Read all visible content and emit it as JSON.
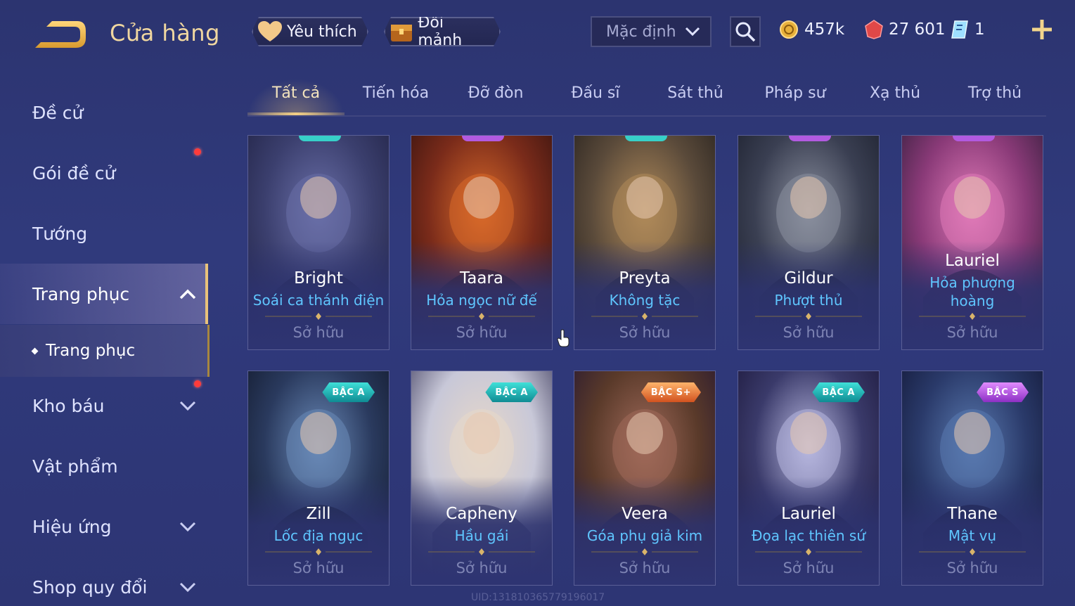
{
  "header": {
    "title": "Cửa hàng",
    "favorites_label": "Yêu thích",
    "fragments_label": "Đổi mảnh",
    "sort_value": "Mặc định",
    "currencies": {
      "gold": "457k",
      "vouchers": "27 601",
      "tickets": "1"
    }
  },
  "sidebar": {
    "items": [
      {
        "label": "Đề cử",
        "has_dot": false
      },
      {
        "label": "Gói đề cử",
        "has_dot": true
      },
      {
        "label": "Tướng",
        "has_dot": false
      },
      {
        "label": "Trang phục",
        "expanded": true,
        "active": true
      },
      {
        "label": "Kho báu",
        "has_dot": true,
        "expandable": true
      },
      {
        "label": "Vật phẩm",
        "has_dot": false
      },
      {
        "label": "Hiệu ứng",
        "expandable": true
      },
      {
        "label": "Shop quy đổi",
        "expandable": true
      }
    ],
    "sub_item": "Trang phục"
  },
  "tabs": [
    "Tất cả",
    "Tiến hóa",
    "Đỡ đòn",
    "Đấu sĩ",
    "Sát thủ",
    "Pháp sư",
    "Xạ thủ",
    "Trợ thủ"
  ],
  "active_tab": "Tất cả",
  "owned_label": "Sở hữu",
  "cards": [
    {
      "hero": "Bright",
      "skin": "Soái ca thánh điện",
      "tier_color": "#37d0c8",
      "art": [
        "#3b3f6e",
        "#6a6fa8",
        "#232548"
      ]
    },
    {
      "hero": "Taara",
      "skin": "Hỏa ngọc nữ đế",
      "tier_color": "#b25ae0",
      "art": [
        "#7a2b1a",
        "#d86a2a",
        "#3a1410"
      ]
    },
    {
      "hero": "Preyta",
      "skin": "Không tặc",
      "tier_color": "#37d0c8",
      "art": [
        "#5a4a3a",
        "#b08a5a",
        "#2a2420"
      ]
    },
    {
      "hero": "Gildur",
      "skin": "Phượt thủ",
      "tier_color": "#b25ae0",
      "art": [
        "#3a3f52",
        "#8a8f9e",
        "#1e2230"
      ]
    },
    {
      "hero": "Lauriel",
      "skin": "Hỏa phượng hoàng",
      "tier_color": "#b25ae0",
      "art": [
        "#8a3a78",
        "#e07ab8",
        "#3a2040"
      ]
    },
    {
      "hero": "Zill",
      "skin": "Lốc địa ngục",
      "tier": "BẬC A",
      "tier_class": "a",
      "art": [
        "#2a3a5e",
        "#6a8ab8",
        "#141c30"
      ]
    },
    {
      "hero": "Capheny",
      "skin": "Hầu gái",
      "tier": "BẬC A",
      "tier_class": "a",
      "art": [
        "#c8c8d8",
        "#e8d8c8",
        "#4a4868"
      ]
    },
    {
      "hero": "Veera",
      "skin": "Góa phụ giả kim",
      "tier": "BẬC S+",
      "tier_class": "sp",
      "art": [
        "#5a3a2a",
        "#a06a5a",
        "#2a1a30"
      ]
    },
    {
      "hero": "Lauriel",
      "skin": "Đọa lạc thiên sứ",
      "tier": "BẬC A",
      "tier_class": "a",
      "art": [
        "#3a3a6a",
        "#b8b8e0",
        "#1e1a3e"
      ]
    },
    {
      "hero": "Thane",
      "skin": "Mật vụ",
      "tier": "BẬC S",
      "tier_class": "s",
      "art": [
        "#2a3a6a",
        "#5a7ab0",
        "#141a3a"
      ]
    }
  ],
  "watermark": "UID:131810365779196017"
}
